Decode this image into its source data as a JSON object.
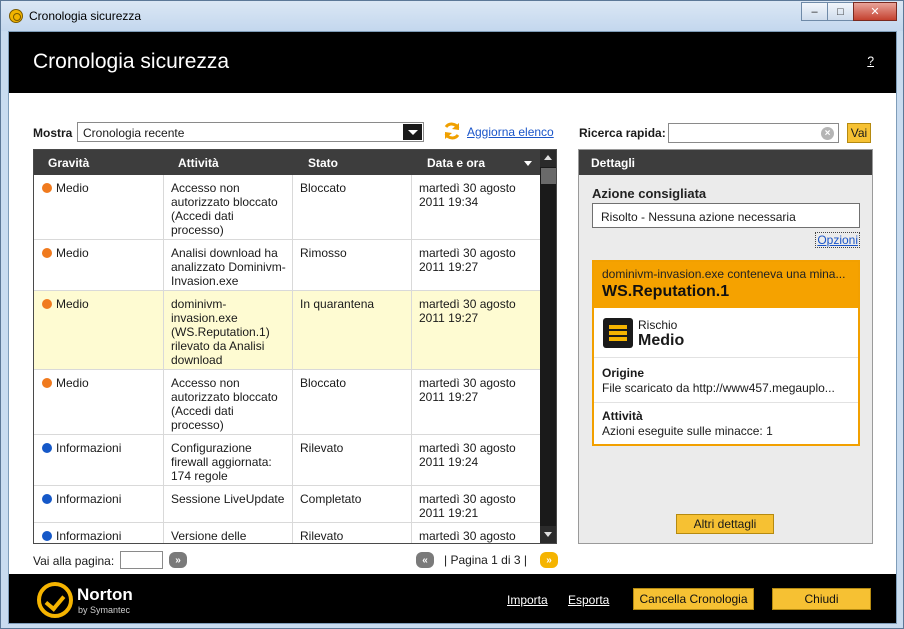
{
  "window": {
    "title": "Cronologia sicurezza",
    "controls": [
      "–",
      "□",
      "✕"
    ]
  },
  "header": {
    "title": "Cronologia sicurezza",
    "help": "?"
  },
  "filter": {
    "label": "Mostra",
    "selected": "Cronologia recente",
    "refresh_label": "Aggiorna elenco"
  },
  "table": {
    "columns": [
      "Gravità",
      "Attività",
      "Stato",
      "Data e ora"
    ],
    "rows": [
      {
        "severity": "Medio",
        "severity_color": "#f07a1e",
        "activity": "Accesso non autorizzato bloccato (Accedi dati processo)",
        "status": "Bloccato",
        "datetime": "martedì 30 agosto 2011 19:34"
      },
      {
        "severity": "Medio",
        "severity_color": "#f07a1e",
        "activity": "Analisi download ha analizzato Dominivm-Invasion.exe",
        "status": "Rimosso",
        "datetime": "martedì 30 agosto 2011 19:27"
      },
      {
        "severity": "Medio",
        "severity_color": "#f07a1e",
        "activity": "dominivm-invasion.exe (WS.Reputation.1) rilevato da Analisi download",
        "status": "In quarantena",
        "datetime": "martedì 30 agosto 2011 19:27"
      },
      {
        "severity": "Medio",
        "severity_color": "#f07a1e",
        "activity": "Accesso non autorizzato bloccato (Accedi dati processo)",
        "status": "Bloccato",
        "datetime": "martedì 30 agosto 2011 19:27"
      },
      {
        "severity": "Informazioni",
        "severity_color": "#1558c8",
        "activity": "Configurazione firewall aggiornata: 174 regole",
        "status": "Rilevato",
        "datetime": "martedì 30 agosto 2011 19:24"
      },
      {
        "severity": "Informazioni",
        "severity_color": "#1558c8",
        "activity": "Sessione LiveUpdate",
        "status": "Completato",
        "datetime": "martedì 30 agosto 2011 19:21"
      },
      {
        "severity": "Informazioni",
        "severity_color": "#1558c8",
        "activity": "Versione delle",
        "status": "Rilevato",
        "datetime": "martedì 30 agosto"
      }
    ]
  },
  "pagination": {
    "goto_label": "Vai alla pagina:",
    "page_text": "| Pagina 1 di 3 |"
  },
  "search": {
    "label": "Ricerca rapida:",
    "value": "",
    "button": "Vai"
  },
  "details": {
    "header": "Dettagli",
    "recommended_title": "Azione consigliata",
    "recommended_value": "Risolto - Nessuna azione necessaria",
    "options_link": "Opzioni",
    "threat_file": "dominivm-invasion.exe conteneva una mina...",
    "threat_name": "WS.Reputation.1",
    "risk_label": "Rischio",
    "risk_value": "Medio",
    "origin_label": "Origine",
    "origin_value": "File scaricato da http://www457.megauplo...",
    "activity_label": "Attività",
    "activity_value": "Azioni eseguite sulle minacce: 1",
    "more_button": "Altri dettagli"
  },
  "footer": {
    "brand": "Norton",
    "brand_sub": "by Symantec",
    "import_link": "Importa",
    "export_link": "Esporta",
    "clear_button": "Cancella Cronologia",
    "close_button": "Chiudi"
  }
}
